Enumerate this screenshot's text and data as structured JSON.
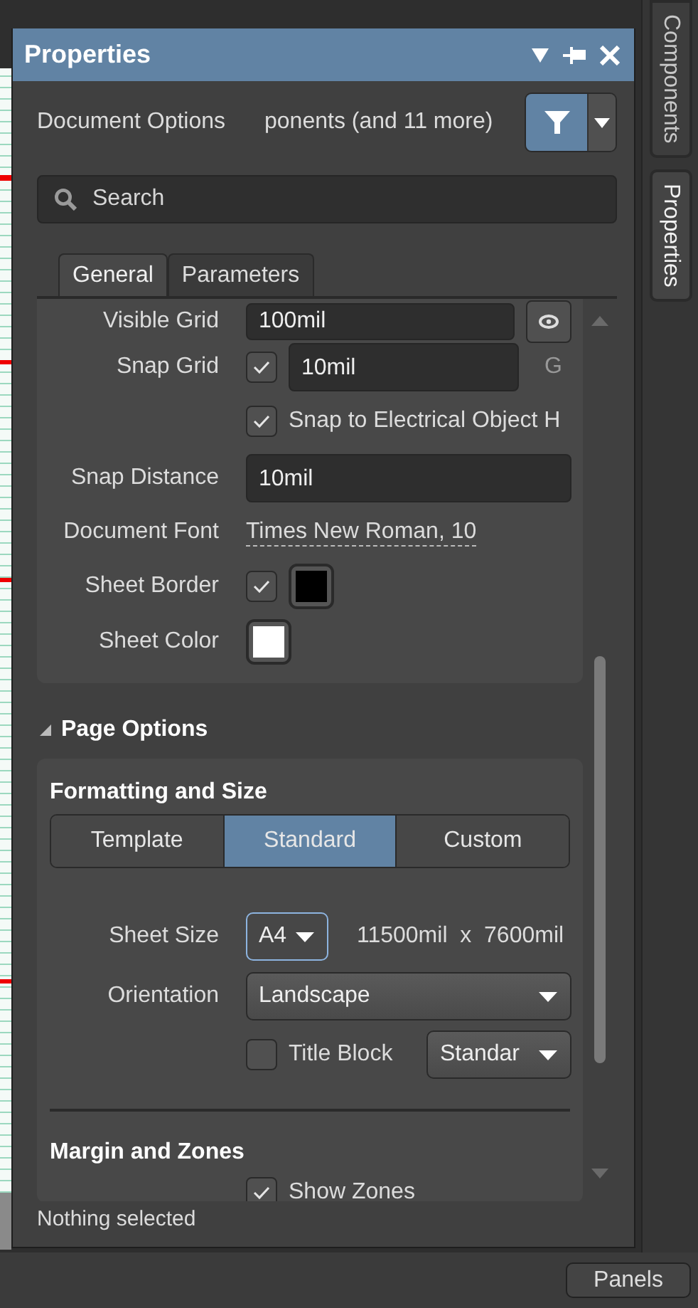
{
  "window": {
    "title": "Properties"
  },
  "side_tabs": [
    {
      "label": "Components",
      "selected": false
    },
    {
      "label": "Properties",
      "selected": true
    }
  ],
  "header": {
    "label": "Document Options",
    "filter_text": "ponents (and 11 more)",
    "filter_on": true
  },
  "search": {
    "placeholder": "Search"
  },
  "tabs": [
    {
      "label": "General",
      "selected": true
    },
    {
      "label": "Parameters",
      "selected": false
    }
  ],
  "general_rows": [
    {
      "kind": "field-button",
      "label": "Visible Grid",
      "value": "100mil"
    },
    {
      "kind": "check-field",
      "label": "Snap Grid",
      "checked": true,
      "value": "10mil",
      "suffix": "G"
    },
    {
      "kind": "check",
      "text": "Snap to Electrical Object H",
      "checked": true
    },
    {
      "kind": "field",
      "label": "Snap Distance",
      "value": "10mil"
    },
    {
      "kind": "link",
      "label": "Document Font",
      "value": "Times New Roman, 10"
    },
    {
      "kind": "check-color",
      "label": "Sheet Border",
      "checked": true,
      "color": "#000000"
    },
    {
      "kind": "color",
      "label": "Sheet Color",
      "color": "#ffffff"
    }
  ],
  "page_options": {
    "title": "Page Options",
    "expanded": true,
    "formatting": {
      "title": "Formatting and Size",
      "modes": [
        {
          "label": "Template",
          "selected": false
        },
        {
          "label": "Standard",
          "selected": true
        },
        {
          "label": "Custom",
          "selected": false
        }
      ]
    },
    "sheet_size": {
      "label": "Sheet Size",
      "value": "A4",
      "dimensions": "11500mil  x  7600mil"
    },
    "orientation": {
      "label": "Orientation",
      "value": "Landscape"
    },
    "title_block": {
      "label": "Title Block",
      "checked": false,
      "value": "Standar"
    },
    "margin": {
      "title": "Margin and Zones",
      "show_zones": {
        "label": "Show Zones",
        "checked": true
      }
    }
  },
  "status": "Nothing selected",
  "panels_button": "Panels"
}
